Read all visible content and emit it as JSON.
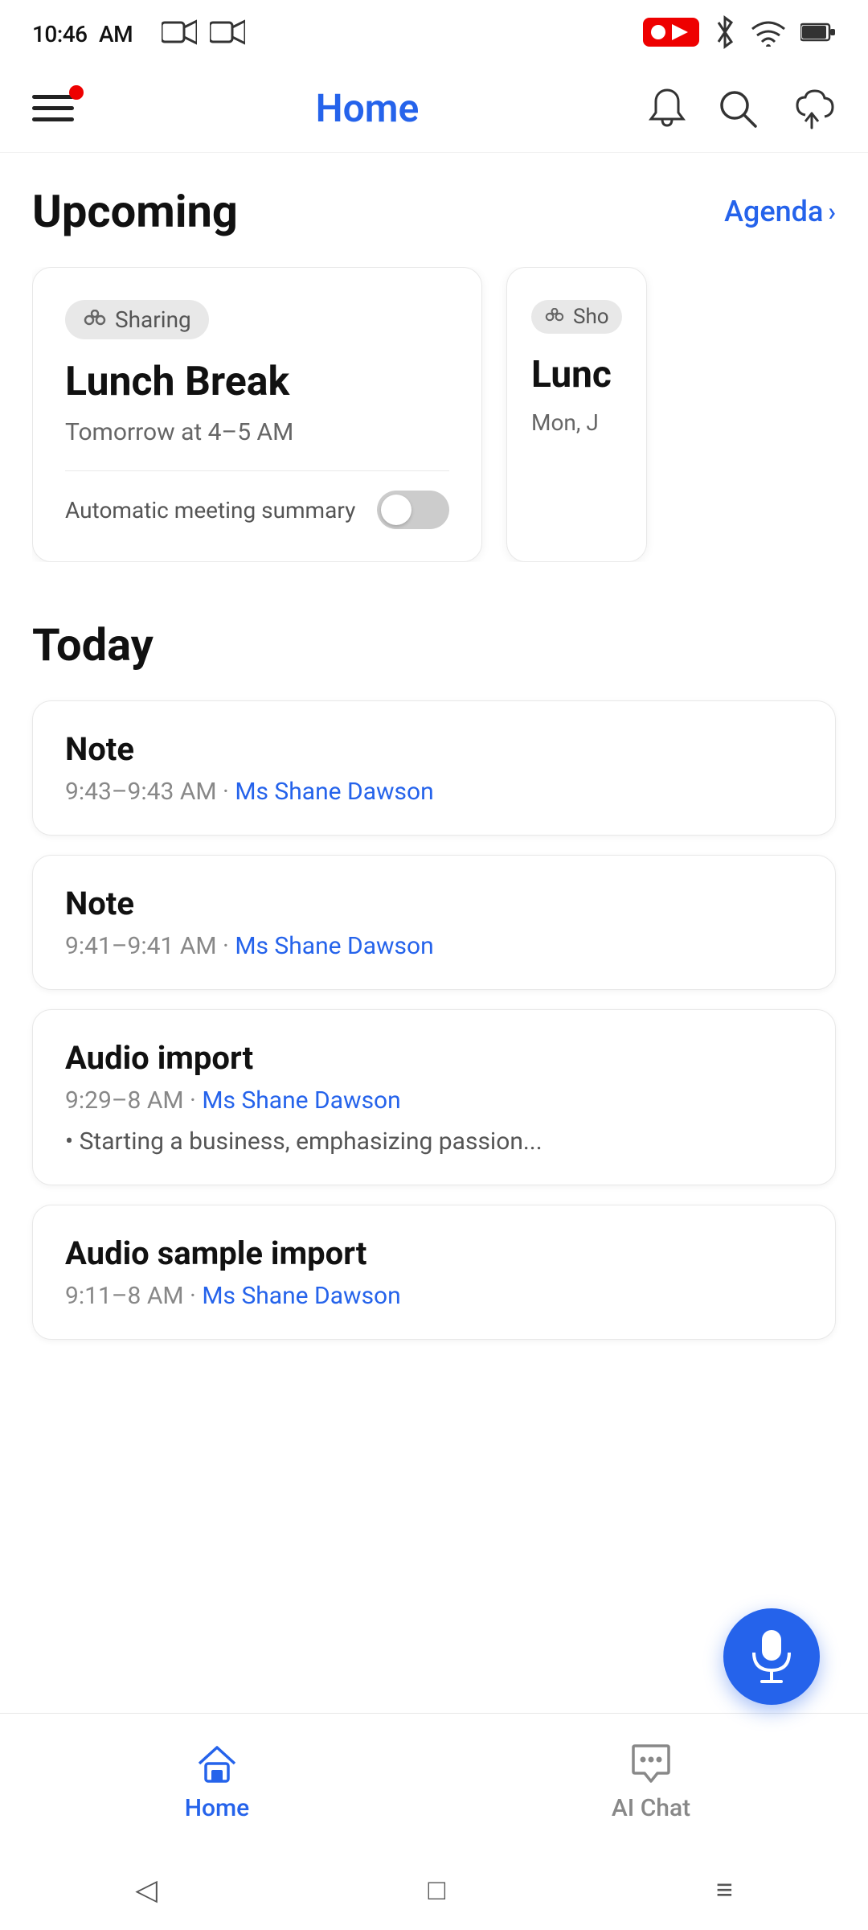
{
  "statusBar": {
    "time": "10:46",
    "ampm": "AM"
  },
  "header": {
    "title": "Home",
    "notification_dot": true
  },
  "upcoming": {
    "section_title": "Upcoming",
    "agenda_label": "Agenda",
    "card1": {
      "badge": "Sharing",
      "title": "Lunch Break",
      "subtitle": "Tomorrow at 4–5 AM",
      "footer_label": "Automatic meeting summary",
      "toggle_on": false
    },
    "card2": {
      "badge": "Sho",
      "title": "Lunc",
      "subtitle": "Mon, J"
    }
  },
  "today": {
    "section_title": "Today",
    "items": [
      {
        "title": "Note",
        "meta": "9:43–9:43 AM",
        "owner": "Ms Shane Dawson",
        "bullet": null
      },
      {
        "title": "Note",
        "meta": "9:41–9:41 AM",
        "owner": "Ms Shane Dawson",
        "bullet": null
      },
      {
        "title": "Audio import",
        "meta": "9:29–8 AM",
        "owner": "Ms Shane Dawson",
        "bullet": "Starting a business, emphasizing passion..."
      },
      {
        "title": "Audio sample import",
        "meta": "9:11–8 AM",
        "owner": "Ms Shane Dawson",
        "bullet": null
      }
    ]
  },
  "bottomNav": {
    "home_label": "Home",
    "ai_chat_label": "AI Chat",
    "active": "home"
  },
  "systemBar": {
    "back": "◁",
    "home": "□",
    "menu": "≡"
  }
}
